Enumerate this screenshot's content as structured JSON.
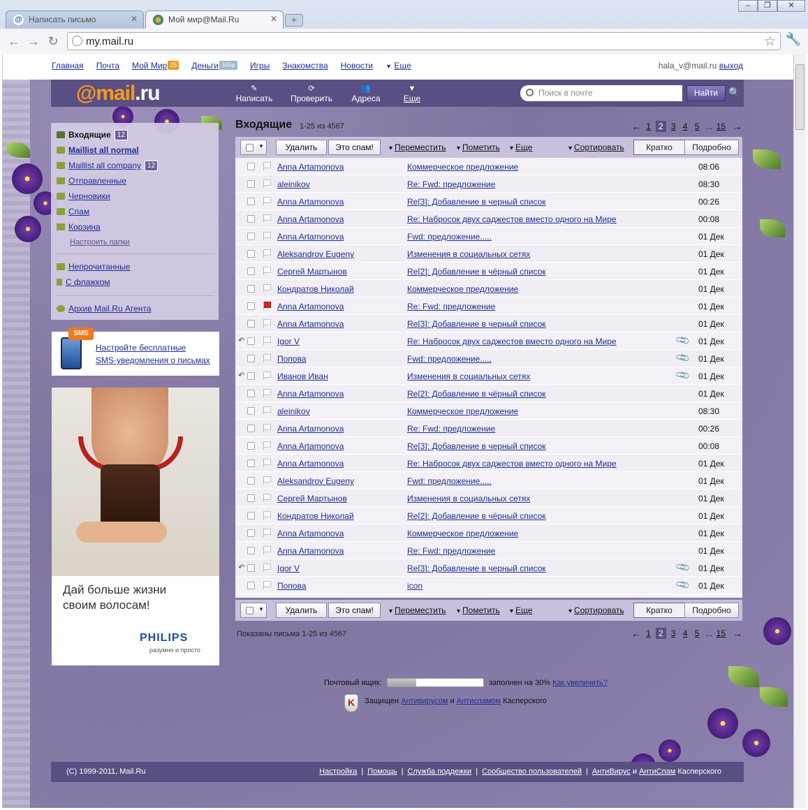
{
  "browser": {
    "tabs": [
      {
        "title": "Написать письмо",
        "active": false
      },
      {
        "title": "Мой мир@Mail.Ru",
        "active": true
      }
    ],
    "url": "my.mail.ru"
  },
  "portal": {
    "links": [
      {
        "label": "Главная"
      },
      {
        "label": "Почта"
      },
      {
        "label": "Мой Мир",
        "badge": "25",
        "badge_color": "#f29a1d"
      },
      {
        "label": "Деньги",
        "badge": "345р",
        "badge_color": "#9ab6d4"
      },
      {
        "label": "Игры"
      },
      {
        "label": "Знакомства"
      },
      {
        "label": "Новости"
      },
      {
        "label": "Еще"
      }
    ],
    "user_email": "hala_v@mail.ru",
    "logout": "выход"
  },
  "mailbar": {
    "logo_at": "@mail",
    "logo_ru": ".ru",
    "actions": [
      {
        "label": "Написать",
        "icon": "pencil-icon"
      },
      {
        "label": "Проверить",
        "icon": "refresh-icon"
      },
      {
        "label": "Адреса",
        "icon": "contacts-icon"
      },
      {
        "label": "Еще",
        "icon": "chevron-down-icon"
      }
    ],
    "search_placeholder": "Поиск в почте",
    "search_button": "Найти",
    "accent": "#5a4f82"
  },
  "folders": [
    {
      "label": "Входящие",
      "count": "12",
      "bold": true,
      "color": "#5b6e3a"
    },
    {
      "label": "Maillist all normal",
      "count": "",
      "bold": true,
      "color": "#8aa03a"
    },
    {
      "label": "Maillist all company",
      "count": "12",
      "bold": false,
      "color": "#8aa03a"
    },
    {
      "label": "Отправленные",
      "count": "",
      "bold": false,
      "color": "#8aa03a"
    },
    {
      "label": "Черновики",
      "count": "",
      "bold": false,
      "color": "#8aa03a"
    },
    {
      "label": "Спам",
      "count": "",
      "bold": false,
      "color": "#8aa03a"
    },
    {
      "label": "Корзина",
      "count": "",
      "bold": false,
      "color": "#8aa03a"
    }
  ],
  "folders_setup": "Настроить папки",
  "filters": [
    {
      "label": "Непрочитанные"
    },
    {
      "label": "С флажком"
    }
  ],
  "agent_archive": "Архив Mail.Ru Агента",
  "sms": {
    "badge": "SMS",
    "line1": "Настройте бесплатные",
    "line2": "SMS-уведомления о письмах"
  },
  "ad": {
    "line1": "Дай больше жизни",
    "line2": "своим волосам!",
    "brand": "PHILIPS",
    "slogan": "разумно и просто"
  },
  "inbox": {
    "title": "Входящие",
    "range": "1-25 из 4567",
    "pages": [
      "1",
      "2",
      "3",
      "4",
      "5",
      "...",
      "15"
    ],
    "current_page": "2",
    "toolbar": {
      "delete": "Удалить",
      "spam": "Это спам!",
      "move": "Переместить",
      "mark": "Пометить",
      "more": "Еще",
      "sort": "Сортировать",
      "brief": "Кратко",
      "detail": "Подробно"
    },
    "messages": [
      {
        "from": "Anna Artamonova",
        "subject": "Коммерческое предложение",
        "time": "08:06",
        "replied": false,
        "flag": false,
        "attach": false
      },
      {
        "from": "aleinikov",
        "subject": "Re: Fwd: предложение",
        "time": "08:30",
        "replied": false,
        "flag": false,
        "attach": false
      },
      {
        "from": "Anna Artamonova",
        "subject": "Re[3]: Добавление в черный список",
        "time": "00:26",
        "replied": false,
        "flag": false,
        "attach": false
      },
      {
        "from": "Anna Artamonova",
        "subject": "Re: Набросок двух саджестов вместо одного на Мире",
        "time": "00:08",
        "replied": false,
        "flag": false,
        "attach": false
      },
      {
        "from": "Anna Artamonova",
        "subject": "Fwd: предложение.....",
        "time": "01 Дек",
        "replied": false,
        "flag": false,
        "attach": false
      },
      {
        "from": "Aleksandrov Eugeny",
        "subject": "Изменения в социальных сетях",
        "time": "01 Дек",
        "replied": false,
        "flag": false,
        "attach": false
      },
      {
        "from": "Сергей Мартынов",
        "subject": "Re[2]: Добавление в чёрный список",
        "time": "01 Дек",
        "replied": false,
        "flag": false,
        "attach": false
      },
      {
        "from": "Кондратов Николай",
        "subject": "Коммерческое предложение",
        "time": "01 Дек",
        "replied": false,
        "flag": false,
        "attach": false
      },
      {
        "from": "Anna Artamonova",
        "subject": "Re: Fwd: предложение",
        "time": "01 Дек",
        "replied": false,
        "flag": true,
        "attach": false
      },
      {
        "from": "Anna Artamonova",
        "subject": "Re[3]: Добавление в черный список",
        "time": "01 Дек",
        "replied": false,
        "flag": false,
        "attach": false
      },
      {
        "from": "Igor V",
        "subject": "Re: Набросок двух саджестов вместо одного на Мире",
        "time": "01 Дек",
        "replied": true,
        "flag": false,
        "attach": true
      },
      {
        "from": "Попова",
        "subject": "Fwd: предложение.....",
        "time": "01 Дек",
        "replied": false,
        "flag": false,
        "attach": true
      },
      {
        "from": "Иванов Иван",
        "subject": "Изменения в социальных сетях",
        "time": "01 Дек",
        "replied": true,
        "flag": false,
        "attach": true
      },
      {
        "from": "Anna Artamonova",
        "subject": "Re[2]: Добавление в чёрный список",
        "time": "01 Дек",
        "replied": false,
        "flag": false,
        "attach": false
      },
      {
        "from": "aleinikov",
        "subject": "Коммерческое предложение",
        "time": "08:30",
        "replied": false,
        "flag": false,
        "attach": false
      },
      {
        "from": "Anna Artamonova",
        "subject": "Re: Fwd: предложение",
        "time": "00:26",
        "replied": false,
        "flag": false,
        "attach": false
      },
      {
        "from": "Anna Artamonova",
        "subject": "Re[3]: Добавление в черный список",
        "time": "00:08",
        "replied": false,
        "flag": false,
        "attach": false
      },
      {
        "from": "Anna Artamonova",
        "subject": "Re: Набросок двух саджестов вместо одного на Мире",
        "time": "01 Дек",
        "replied": false,
        "flag": false,
        "attach": false
      },
      {
        "from": "Aleksandrov Eugeny",
        "subject": "Fwd: предложение.....",
        "time": "01 Дек",
        "replied": false,
        "flag": false,
        "attach": false
      },
      {
        "from": "Сергей Мартынов",
        "subject": "Изменения в социальных сетях",
        "time": "01 Дек",
        "replied": false,
        "flag": false,
        "attach": false
      },
      {
        "from": "Кондратов Николай",
        "subject": "Re[2]: Добавление в чёрный список",
        "time": "01 Дек",
        "replied": false,
        "flag": false,
        "attach": false
      },
      {
        "from": "Anna Artamonova",
        "subject": "Коммерческое предложение",
        "time": "01 Дек",
        "replied": false,
        "flag": false,
        "attach": false
      },
      {
        "from": "Anna Artamonova",
        "subject": "Re: Fwd: предложение",
        "time": "01 Дек",
        "replied": false,
        "flag": false,
        "attach": false
      },
      {
        "from": "Igor V",
        "subject": "Re[3]: Добавление в черный список",
        "time": "01 Дек",
        "replied": true,
        "flag": false,
        "attach": true
      },
      {
        "from": "Попова",
        "subject": "icon",
        "time": "01 Дек",
        "replied": false,
        "flag": false,
        "attach": true
      }
    ],
    "shown": "Показаны письма 1-25 из 4567"
  },
  "quota": {
    "label": "Почтовый ящик:",
    "filled_fraction": 0.3,
    "filled_text": "заполнен на 30%",
    "increase": "Как увеличить?"
  },
  "kaspersky": {
    "prefix": "Защищен",
    "antivirus": "Антивирусом",
    "and": "и",
    "antispam": "Антиспамом",
    "suffix": "Касперского"
  },
  "footer": {
    "copyright": "(C) 1999-2011, Mail.Ru",
    "links": [
      "Настройка",
      "Помощь",
      "Служба поддежки",
      "Сообщество пользователей"
    ],
    "antivirus": "АнтиВирус",
    "and": "и",
    "antispam": "АнтиСпам",
    "kasp": "Касперского"
  }
}
